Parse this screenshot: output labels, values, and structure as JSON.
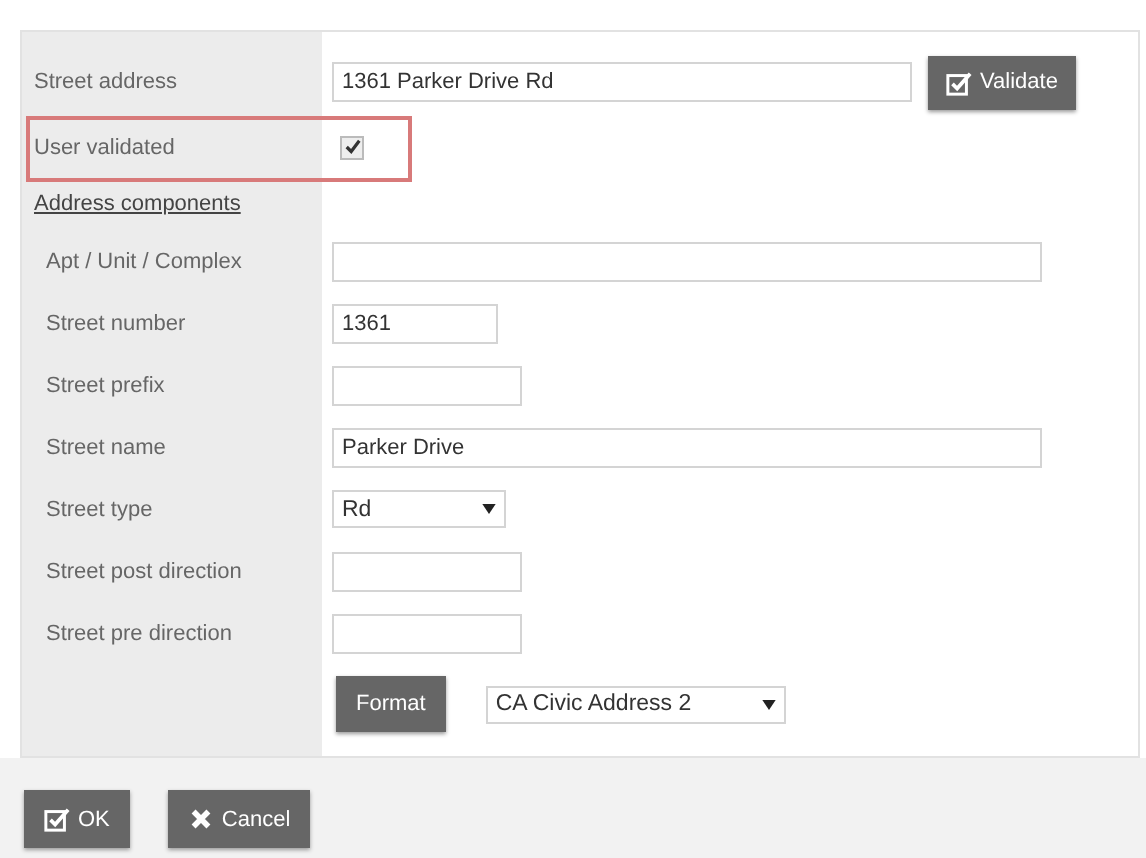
{
  "street_address": {
    "label": "Street address",
    "value": "1361 Parker Drive Rd",
    "button": "Validate"
  },
  "user_validated": {
    "label": "User validated",
    "checked": true,
    "highlighted": true
  },
  "section_title": "Address components",
  "components": [
    {
      "label": "Apt / Unit / Complex",
      "kind": "text"
    },
    {
      "label": "Street number",
      "kind": "text",
      "value": "1361"
    },
    {
      "label": "Street prefix",
      "kind": "text"
    },
    {
      "label": "Street name",
      "kind": "text",
      "value": "Parker Drive"
    },
    {
      "label": "Street type",
      "kind": "select",
      "value": "Rd"
    },
    {
      "label": "Street post direction",
      "kind": "text"
    },
    {
      "label": "Street pre direction",
      "kind": "text"
    }
  ],
  "format": {
    "button": "Format",
    "value": "CA Civic Address 2"
  },
  "buttons": [
    {
      "label": "OK",
      "kind": "ok"
    },
    {
      "label": "Cancel",
      "kind": "cancel"
    }
  ]
}
